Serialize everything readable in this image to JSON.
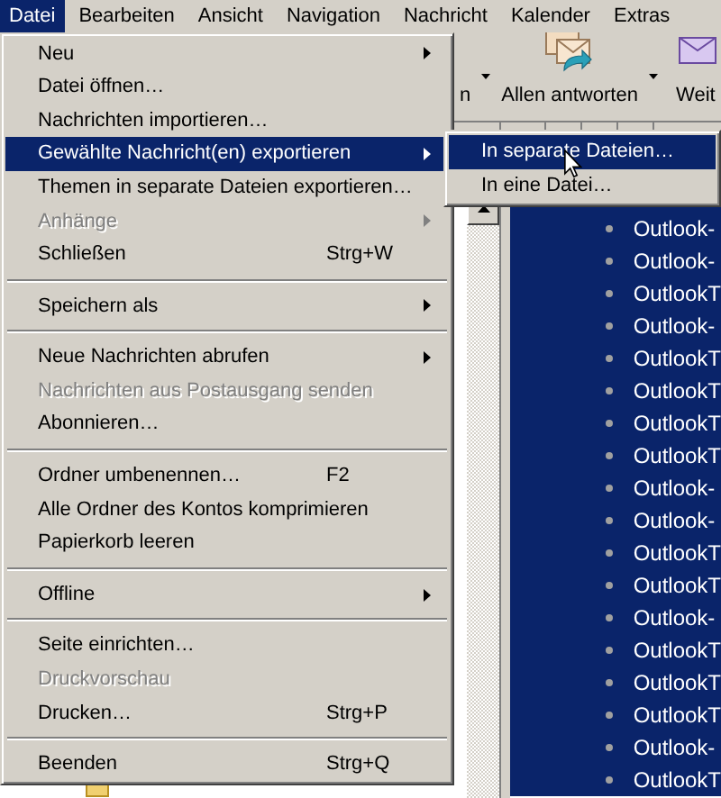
{
  "menu_bar": [
    {
      "label": "Datei",
      "selected": true
    },
    {
      "label": "Bearbeiten",
      "selected": false
    },
    {
      "label": "Ansicht",
      "selected": false
    },
    {
      "label": "Navigation",
      "selected": false
    },
    {
      "label": "Nachricht",
      "selected": false
    },
    {
      "label": "Kalender",
      "selected": false
    },
    {
      "label": "Extras",
      "selected": false
    }
  ],
  "toolbar": [
    {
      "label": "n",
      "dropdown": true,
      "icon": false
    },
    {
      "label": "Allen antworten",
      "dropdown": true,
      "icon": true
    },
    {
      "label": "Weit",
      "dropdown": false,
      "icon": true
    }
  ],
  "file_menu": [
    {
      "kind": "item",
      "label": "Neu",
      "submenu": true,
      "disabled": false,
      "selected": false
    },
    {
      "kind": "item",
      "label": "Datei öffnen…",
      "submenu": false,
      "disabled": false,
      "selected": false
    },
    {
      "kind": "item",
      "label": "Nachrichten importieren…",
      "submenu": false,
      "disabled": false,
      "selected": false
    },
    {
      "kind": "item",
      "label": "Gewählte Nachricht(en) exportieren",
      "submenu": true,
      "disabled": false,
      "selected": true
    },
    {
      "kind": "item",
      "label": "Themen in separate Dateien exportieren…",
      "submenu": false,
      "disabled": false,
      "selected": false
    },
    {
      "kind": "item",
      "label": "Anhänge",
      "submenu": true,
      "disabled": true,
      "selected": false
    },
    {
      "kind": "item",
      "label": "Schließen",
      "shortcut": "Strg+W",
      "submenu": false,
      "disabled": false,
      "selected": false
    },
    {
      "kind": "separator"
    },
    {
      "kind": "item",
      "label": "Speichern als",
      "submenu": true,
      "disabled": false,
      "selected": false
    },
    {
      "kind": "separator"
    },
    {
      "kind": "item",
      "label": "Neue Nachrichten abrufen",
      "submenu": true,
      "disabled": false,
      "selected": false
    },
    {
      "kind": "item",
      "label": "Nachrichten aus Postausgang senden",
      "submenu": false,
      "disabled": true,
      "selected": false
    },
    {
      "kind": "item",
      "label": "Abonnieren…",
      "submenu": false,
      "disabled": false,
      "selected": false
    },
    {
      "kind": "separator"
    },
    {
      "kind": "item",
      "label": "Ordner umbenennen…",
      "shortcut": "F2",
      "submenu": false,
      "disabled": false,
      "selected": false
    },
    {
      "kind": "item",
      "label": "Alle Ordner des Kontos komprimieren",
      "submenu": false,
      "disabled": false,
      "selected": false
    },
    {
      "kind": "item",
      "label": "Papierkorb leeren",
      "submenu": false,
      "disabled": false,
      "selected": false
    },
    {
      "kind": "separator"
    },
    {
      "kind": "item",
      "label": "Offline",
      "submenu": true,
      "disabled": false,
      "selected": false
    },
    {
      "kind": "separator"
    },
    {
      "kind": "item",
      "label": "Seite einrichten…",
      "submenu": false,
      "disabled": false,
      "selected": false
    },
    {
      "kind": "item",
      "label": "Druckvorschau",
      "submenu": false,
      "disabled": true,
      "selected": false
    },
    {
      "kind": "item",
      "label": "Drucken…",
      "shortcut": "Strg+P",
      "submenu": false,
      "disabled": false,
      "selected": false
    },
    {
      "kind": "separator"
    },
    {
      "kind": "item",
      "label": "Beenden",
      "shortcut": "Strg+Q",
      "submenu": false,
      "disabled": false,
      "selected": false
    }
  ],
  "export_submenu": [
    {
      "label": "In separate Dateien…",
      "selected": true
    },
    {
      "label": "In eine Datei…",
      "selected": false
    }
  ],
  "folder_tree": [
    {
      "kind": "folder"
    }
  ],
  "message_list": [
    {
      "subject": "Outlook-",
      "selected": true
    },
    {
      "subject": "Outlook-",
      "selected": true
    },
    {
      "subject": "OutlookT",
      "selected": true
    },
    {
      "subject": "Outlook-",
      "selected": true
    },
    {
      "subject": "OutlookT",
      "selected": true
    },
    {
      "subject": "OutlookT",
      "selected": true
    },
    {
      "subject": "OutlookT",
      "selected": true
    },
    {
      "subject": "OutlookT",
      "selected": true
    },
    {
      "subject": "Outlook-",
      "selected": true
    },
    {
      "subject": "Outlook-",
      "selected": true
    },
    {
      "subject": "OutlookT",
      "selected": true
    },
    {
      "subject": "OutlookT",
      "selected": true
    },
    {
      "subject": "Outlook-",
      "selected": true
    },
    {
      "subject": "OutlookT",
      "selected": true
    },
    {
      "subject": "OutlookT",
      "selected": true
    },
    {
      "subject": "OutlookT",
      "selected": true
    },
    {
      "subject": "Outlook-",
      "selected": true
    },
    {
      "subject": "OutlookT",
      "selected": true
    }
  ]
}
